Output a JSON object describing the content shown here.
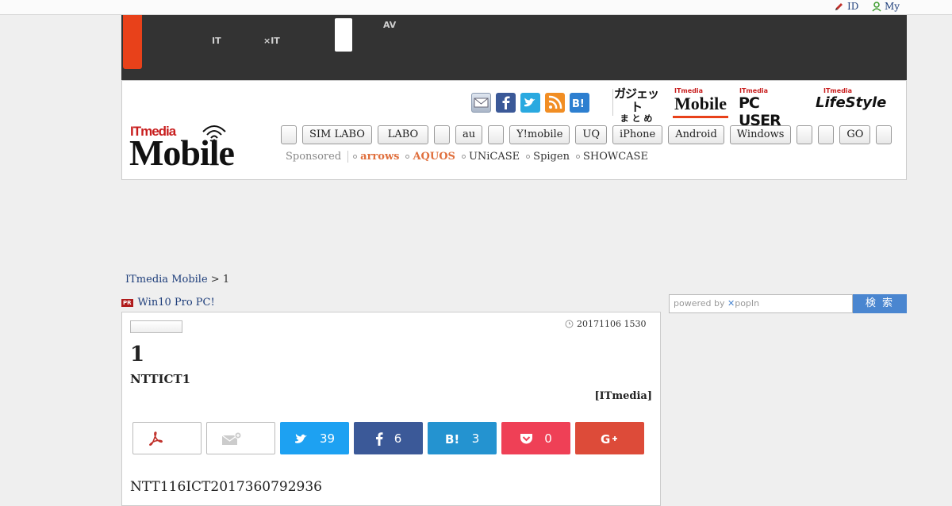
{
  "topbar": {
    "id_label": "ID",
    "my_label": "My"
  },
  "darkhead": {
    "nav": [
      "\n\nIT",
      "\n\n×IT",
      "AV\n"
    ]
  },
  "header": {
    "logo_small": "ITmedia",
    "logo_big": "Mobile",
    "brands": {
      "gadget_line1": "ガジェット",
      "gadget_line2": "ま と め",
      "mobile": "Mobile",
      "pcuser": "PC USER",
      "lifestyle": "LifeStyle",
      "itmedia": "ITmedia"
    },
    "nav_buttons": [
      "",
      "SIM LABO",
      "LABO",
      "",
      "au",
      "",
      "Y!mobile",
      "UQ",
      "iPhone",
      "Android",
      "Windows",
      "",
      "",
      "GO",
      ""
    ],
    "sponsored_label": "Sponsored",
    "sponsored": [
      {
        "label": "arrows",
        "highlight": true
      },
      {
        "label": "AQUOS",
        "highlight": true
      },
      {
        "label": "UNiCASE",
        "highlight": false
      },
      {
        "label": "Spigen",
        "highlight": false
      },
      {
        "label": "SHOWCASE",
        "highlight": false
      }
    ]
  },
  "breadcrumb": {
    "home": "ITmedia Mobile",
    "sep": " > ",
    "current": "1"
  },
  "pr": {
    "badge": "PR",
    "text": "Win10 Pro PC!"
  },
  "search": {
    "placeholder": "powered by ",
    "provider": "popIn",
    "button": "検 索"
  },
  "article": {
    "date": "20171106 1530",
    "title": "1",
    "subtitle": "NTTICT1",
    "byline": "[ITmedia]",
    "share": {
      "twitter": "39",
      "facebook": "6",
      "hatena": "3",
      "pocket": "0"
    },
    "body": "NTT116ICT2017360792936"
  },
  "colors": {
    "accent_orange": "#e8411a",
    "twitter": "#1da1f2",
    "facebook": "#3b5998",
    "hatena": "#2493d0",
    "pocket": "#ef4056",
    "gplus": "#dd4b39"
  }
}
